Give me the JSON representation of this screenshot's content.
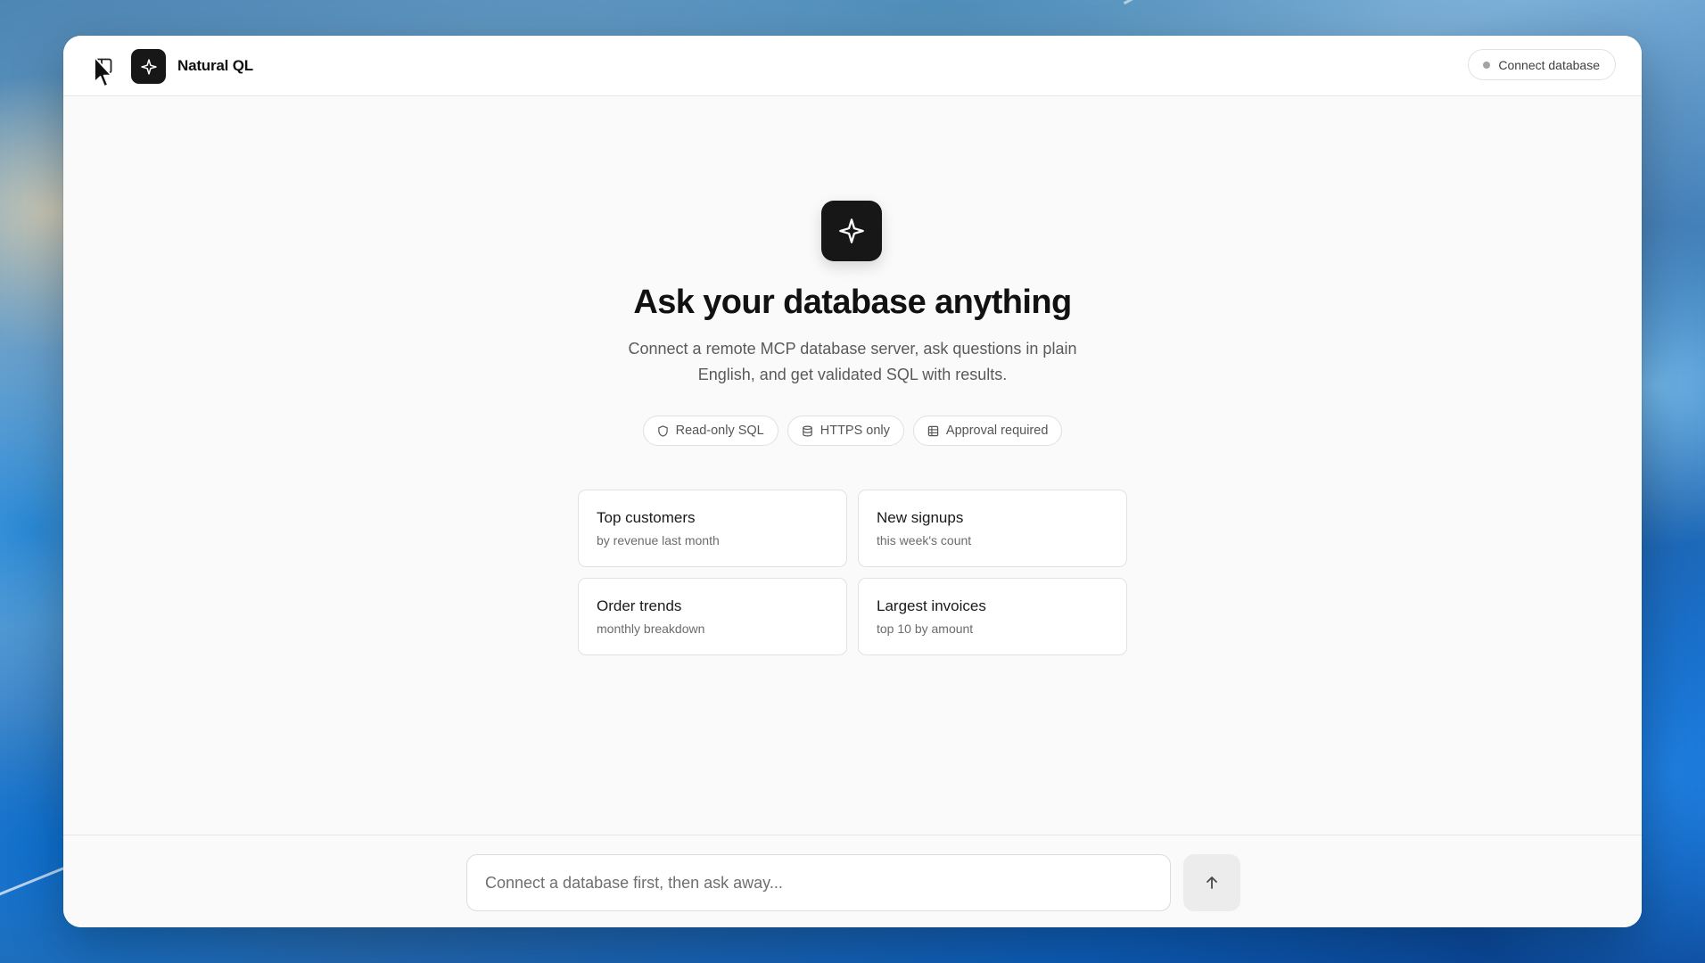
{
  "app": {
    "title": "Natural QL"
  },
  "header": {
    "connect_label": "Connect database",
    "status": "disconnected"
  },
  "hero": {
    "title": "Ask your database anything",
    "subtitle": "Connect a remote MCP database server, ask questions in plain English, and get validated SQL with results."
  },
  "badges": [
    {
      "icon": "shield-icon",
      "label": "Read-only SQL"
    },
    {
      "icon": "database-icon",
      "label": "HTTPS only"
    },
    {
      "icon": "table-icon",
      "label": "Approval required"
    }
  ],
  "suggestions": [
    {
      "title": "Top customers",
      "subtitle": "by revenue last month"
    },
    {
      "title": "New signups",
      "subtitle": "this week's count"
    },
    {
      "title": "Order trends",
      "subtitle": "monthly breakdown"
    },
    {
      "title": "Largest invoices",
      "subtitle": "top 10 by amount"
    }
  ],
  "composer": {
    "placeholder": "Connect a database first, then ask away...",
    "value": ""
  },
  "colors": {
    "accent": "#171717",
    "status_dot": "#a3a3a3",
    "send_button_bg": "#ececec"
  }
}
